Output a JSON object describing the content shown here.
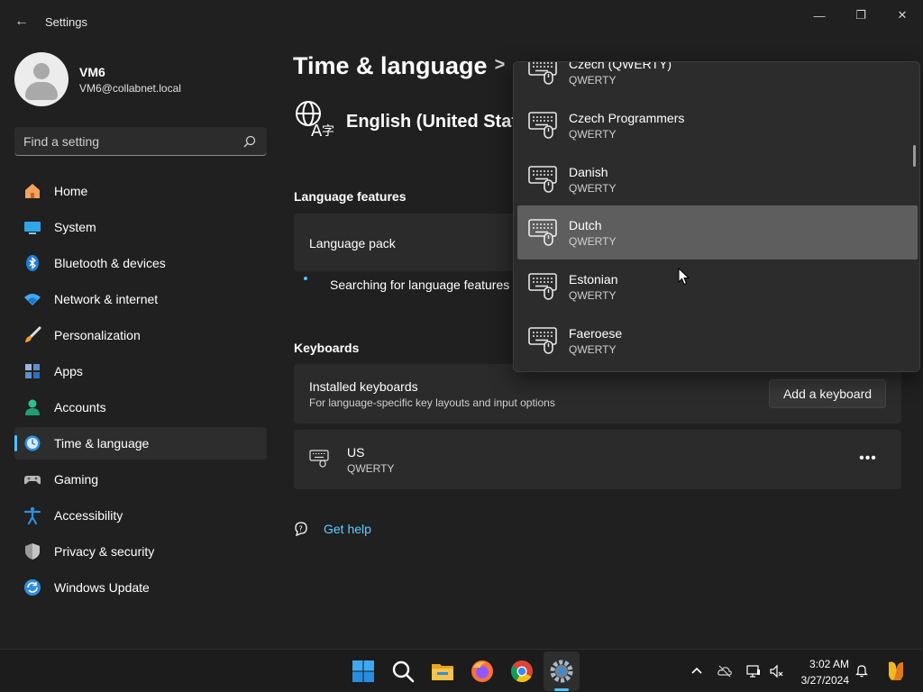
{
  "window": {
    "title": "Settings",
    "back_glyph": "←",
    "minimize_glyph": "—",
    "maximize_glyph": "❐",
    "close_glyph": "✕"
  },
  "profile": {
    "name": "VM6",
    "email": "VM6@collabnet.local"
  },
  "search": {
    "placeholder": "Find a setting",
    "value": ""
  },
  "nav": {
    "items": [
      {
        "label": "Home",
        "icon": "home-icon"
      },
      {
        "label": "System",
        "icon": "system-icon"
      },
      {
        "label": "Bluetooth & devices",
        "icon": "bluetooth-icon"
      },
      {
        "label": "Network & internet",
        "icon": "wifi-icon"
      },
      {
        "label": "Personalization",
        "icon": "brush-icon"
      },
      {
        "label": "Apps",
        "icon": "apps-icon"
      },
      {
        "label": "Accounts",
        "icon": "accounts-icon"
      },
      {
        "label": "Time & language",
        "icon": "time-language-icon"
      },
      {
        "label": "Gaming",
        "icon": "gamepad-icon"
      },
      {
        "label": "Accessibility",
        "icon": "accessibility-icon"
      },
      {
        "label": "Privacy & security",
        "icon": "shield-icon"
      },
      {
        "label": "Windows Update",
        "icon": "update-icon"
      }
    ],
    "selected_index": 7
  },
  "main": {
    "breadcrumb_root": "Time & language",
    "breadcrumb_sep": ">",
    "language_title": "English (United State",
    "language_features_heading": "Language features",
    "language_pack_label": "Language pack",
    "searching_text": "Searching for language features",
    "keyboards_heading": "Keyboards",
    "installed_keyboards_title": "Installed keyboards",
    "installed_keyboards_sub": "For language-specific key layouts and input options",
    "add_keyboard_label": "Add a keyboard",
    "keyboard_entry": {
      "name": "US",
      "layout": "QWERTY"
    },
    "more_glyph": "•••",
    "get_help_label": "Get help"
  },
  "dropdown": {
    "items": [
      {
        "name": "Czech (QWERTY)",
        "layout": "QWERTY"
      },
      {
        "name": "Czech Programmers",
        "layout": "QWERTY"
      },
      {
        "name": "Danish",
        "layout": "QWERTY"
      },
      {
        "name": "Dutch",
        "layout": "QWERTY"
      },
      {
        "name": "Estonian",
        "layout": "QWERTY"
      },
      {
        "name": "Faeroese",
        "layout": "QWERTY"
      }
    ],
    "hover_index": 3
  },
  "taskbar": {
    "apps": [
      "start-icon",
      "search-icon",
      "file-explorer-icon",
      "firefox-icon",
      "chrome-icon",
      "settings-icon"
    ],
    "tray": [
      "chevron-up-icon",
      "onedrive-icon",
      "network-icon",
      "volume-icon"
    ],
    "time": "3:02 AM",
    "date": "3/27/2024"
  },
  "colors": {
    "accent": "#4cc2ff",
    "link": "#60cdff",
    "background": "#202020",
    "card": "#2b2b2b"
  }
}
